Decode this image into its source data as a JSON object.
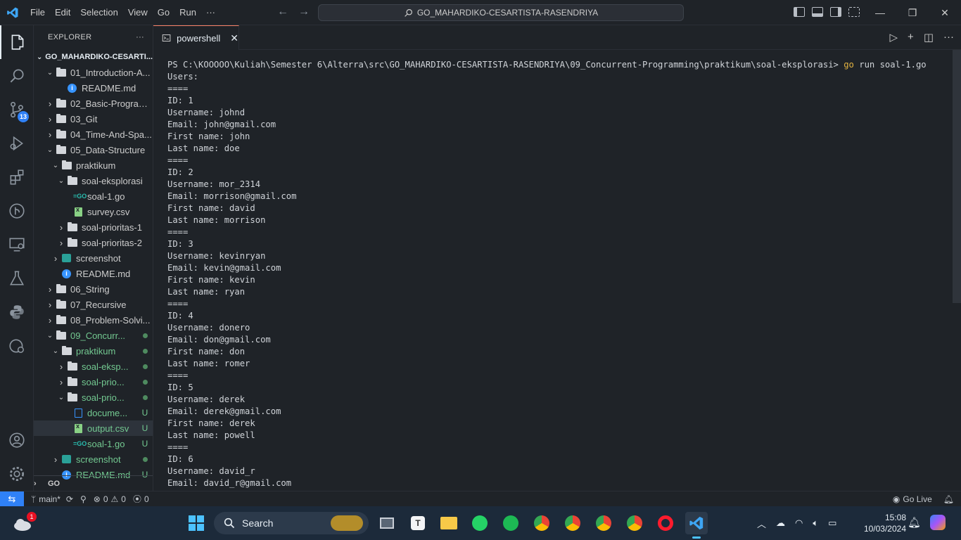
{
  "titlebar": {
    "menu": [
      "File",
      "Edit",
      "Selection",
      "View",
      "Go",
      "Run",
      "···"
    ],
    "search_text": "GO_MAHARDIKO-CESARTISTA-RASENDRIYA"
  },
  "activity": {
    "source_control_badge": "13"
  },
  "sidebar": {
    "title": "EXPLORER",
    "more": "···",
    "root": "GO_MAHARDIKO-CESARTI...",
    "bottom_section": "GO",
    "items": [
      {
        "label": "01_Introduction-A...",
        "indent": 0,
        "chev": "open",
        "icon": "folder",
        "status": ""
      },
      {
        "label": "README.md",
        "indent": 2,
        "chev": "",
        "icon": "info",
        "status": ""
      },
      {
        "label": "02_Basic-Program...",
        "indent": 0,
        "chev": "closed",
        "icon": "folder",
        "status": ""
      },
      {
        "label": "03_Git",
        "indent": 0,
        "chev": "closed",
        "icon": "folder",
        "status": ""
      },
      {
        "label": "04_Time-And-Spa...",
        "indent": 0,
        "chev": "closed",
        "icon": "folder",
        "status": ""
      },
      {
        "label": "05_Data-Structure",
        "indent": 0,
        "chev": "open",
        "icon": "folder",
        "status": ""
      },
      {
        "label": "praktikum",
        "indent": 1,
        "chev": "open",
        "icon": "folder",
        "status": ""
      },
      {
        "label": "soal-eksplorasi",
        "indent": 2,
        "chev": "open",
        "icon": "folder",
        "status": ""
      },
      {
        "label": "soal-1.go",
        "indent": 3,
        "chev": "",
        "icon": "go",
        "status": ""
      },
      {
        "label": "survey.csv",
        "indent": 3,
        "chev": "",
        "icon": "csv",
        "status": ""
      },
      {
        "label": "soal-prioritas-1",
        "indent": 2,
        "chev": "closed",
        "icon": "folder",
        "status": ""
      },
      {
        "label": "soal-prioritas-2",
        "indent": 2,
        "chev": "closed",
        "icon": "folder",
        "status": ""
      },
      {
        "label": "screenshot",
        "indent": 1,
        "chev": "closed",
        "icon": "shot",
        "status": ""
      },
      {
        "label": "README.md",
        "indent": 1,
        "chev": "",
        "icon": "info",
        "status": ""
      },
      {
        "label": "06_String",
        "indent": 0,
        "chev": "closed",
        "icon": "folder",
        "status": ""
      },
      {
        "label": "07_Recursive",
        "indent": 0,
        "chev": "closed",
        "icon": "folder",
        "status": ""
      },
      {
        "label": "08_Problem-Solvi...",
        "indent": 0,
        "chev": "closed",
        "icon": "folder",
        "status": ""
      },
      {
        "label": "09_Concurr...",
        "indent": 0,
        "chev": "open",
        "icon": "folder",
        "status": "dot",
        "git": true
      },
      {
        "label": "praktikum",
        "indent": 1,
        "chev": "open",
        "icon": "folder",
        "status": "dot",
        "git": true
      },
      {
        "label": "soal-eksp...",
        "indent": 2,
        "chev": "closed",
        "icon": "folder",
        "status": "dot",
        "git": true
      },
      {
        "label": "soal-prio...",
        "indent": 2,
        "chev": "closed",
        "icon": "folder",
        "status": "dot",
        "git": true
      },
      {
        "label": "soal-prio...",
        "indent": 2,
        "chev": "open",
        "icon": "folder",
        "status": "dot",
        "git": true
      },
      {
        "label": "docume...",
        "indent": 3,
        "chev": "",
        "icon": "doc",
        "status": "U",
        "git": true
      },
      {
        "label": "output.csv",
        "indent": 3,
        "chev": "",
        "icon": "csv",
        "status": "U",
        "git": true,
        "selected": true
      },
      {
        "label": "soal-1.go",
        "indent": 3,
        "chev": "",
        "icon": "go",
        "status": "U",
        "git": true
      },
      {
        "label": "screenshot",
        "indent": 1,
        "chev": "closed",
        "icon": "shot",
        "status": "dot",
        "git": true
      },
      {
        "label": "README.md",
        "indent": 1,
        "chev": "",
        "icon": "info",
        "status": "U",
        "git": true
      }
    ]
  },
  "tab": {
    "label": "powershell",
    "close": "✕"
  },
  "terminal": {
    "prompt": "PS C:\\KOOOOO\\Kuliah\\Semester 6\\Alterra\\src\\GO_MAHARDIKO-CESARTISTA-RASENDRIYA\\09_Concurrent-Programming\\praktikum\\soal-eksplorasi> ",
    "command_go": "go",
    "command_rest": " run soal-1.go",
    "lines": [
      "Users:",
      "====",
      "ID: 1",
      "Username: johnd",
      "Email: john@gmail.com",
      "First name: john",
      "Last name: doe",
      "====",
      "ID: 2",
      "Username: mor_2314",
      "Email: morrison@gmail.com",
      "First name: david",
      "Last name: morrison",
      "====",
      "ID: 3",
      "Username: kevinryan",
      "Email: kevin@gmail.com",
      "First name: kevin",
      "Last name: ryan",
      "====",
      "ID: 4",
      "Username: donero",
      "Email: don@gmail.com",
      "First name: don",
      "Last name: romer",
      "====",
      "ID: 5",
      "Username: derek",
      "Email: derek@gmail.com",
      "First name: derek",
      "Last name: powell",
      "====",
      "ID: 6",
      "Username: david_r",
      "Email: david_r@gmail.com"
    ]
  },
  "statusbar": {
    "branch": "main*",
    "errors": "0",
    "warnings": "0",
    "ports": "0",
    "golive": "Go Live"
  },
  "taskbar": {
    "search": "Search",
    "weather_badge": "1",
    "time": "15:08",
    "date": "10/03/2024"
  }
}
